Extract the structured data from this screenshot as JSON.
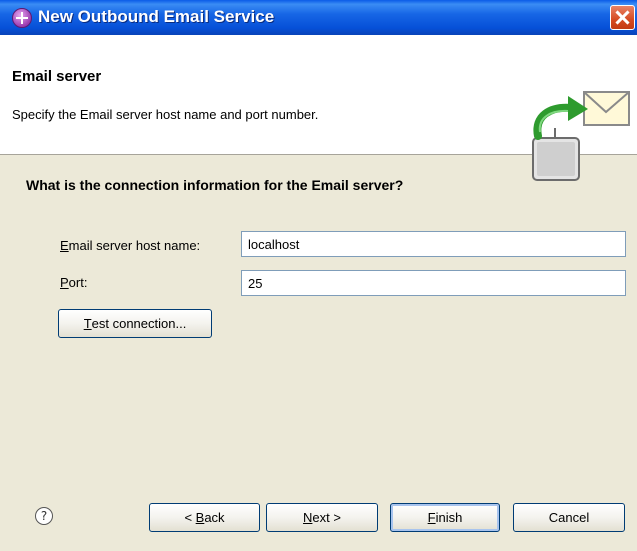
{
  "window": {
    "title": "New Outbound Email Service"
  },
  "header": {
    "title": "Email server",
    "description": "Specify the Email server host name and port number."
  },
  "form": {
    "question": "What is the connection information for the Email server?",
    "host_label_mn": "E",
    "host_label_rest": "mail server host name:",
    "host_value": "localhost",
    "port_label_mn": "P",
    "port_label_rest": "ort:",
    "port_value": "25",
    "test_button_mn": "T",
    "test_button_rest": "est connection..."
  },
  "footer": {
    "help_glyph": "?",
    "back_prefix": "< ",
    "back_mn": "B",
    "back_rest": "ack",
    "next_mn": "N",
    "next_rest": "ext >",
    "finish_mn": "F",
    "finish_rest": "inish",
    "cancel_label": "Cancel"
  },
  "colors": {
    "title_bar": "#0A5BE8",
    "dialog_bg": "#ECE9D8",
    "header_bg": "#FFFFFF",
    "close_button": "#D54A22"
  },
  "icons": [
    "app-icon",
    "close-icon",
    "email-service-wizard-icon",
    "help-icon"
  ]
}
